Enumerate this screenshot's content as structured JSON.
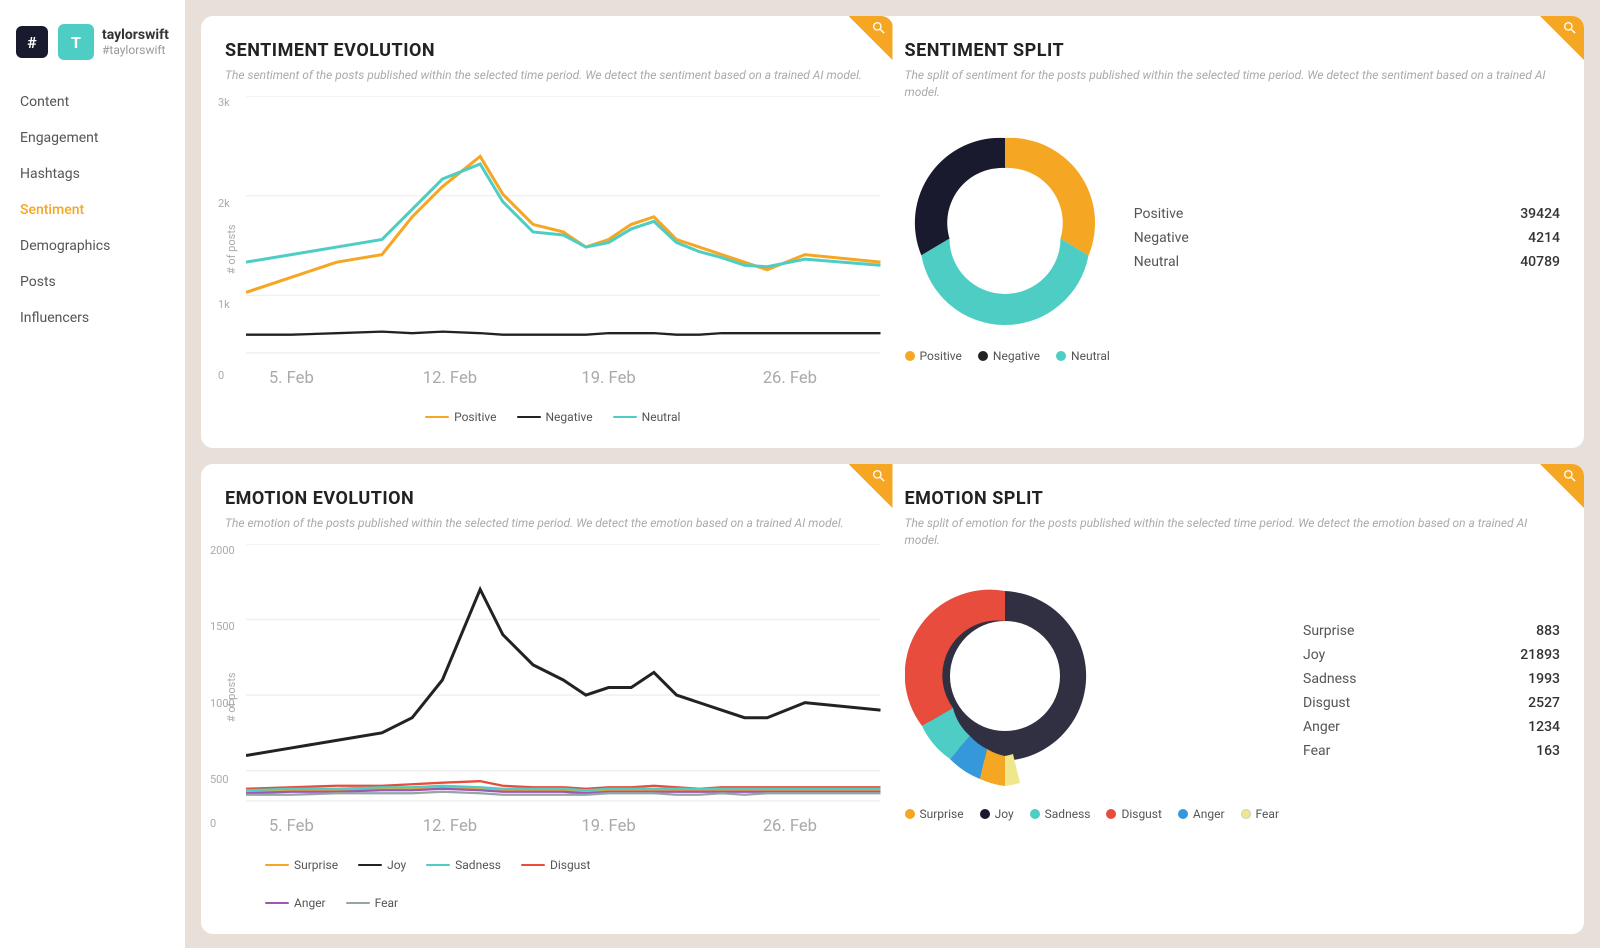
{
  "brand": {
    "hash": "#",
    "avatar_letter": "T",
    "name": "taylorswift",
    "handle": "#taylorswift"
  },
  "nav": {
    "items": [
      {
        "label": "Content",
        "active": false
      },
      {
        "label": "Engagement",
        "active": false
      },
      {
        "label": "Hashtags",
        "active": false
      },
      {
        "label": "Sentiment",
        "active": true
      },
      {
        "label": "Demographics",
        "active": false
      },
      {
        "label": "Posts",
        "active": false
      },
      {
        "label": "Influencers",
        "active": false
      }
    ]
  },
  "sentiment_evolution": {
    "title": "SENTIMENT EVOLUTION",
    "desc": "The sentiment of the posts published within the selected time period. We detect the sentiment based on a trained AI model.",
    "legend": [
      {
        "label": "Positive",
        "color": "#f5a623"
      },
      {
        "label": "Negative",
        "color": "#222222"
      },
      {
        "label": "Neutral",
        "color": "#4ecdc4"
      }
    ],
    "x_labels": [
      "5. Feb",
      "12. Feb",
      "19. Feb",
      "26. Feb"
    ],
    "y_labels": [
      "3k",
      "2k",
      "1k",
      "0"
    ]
  },
  "sentiment_split": {
    "title": "SENTIMENT SPLIT",
    "desc": "The split of sentiment for the posts published within the selected time period. We detect the sentiment based on a trained AI model.",
    "stats": [
      {
        "label": "Positive",
        "value": "39424"
      },
      {
        "label": "Negative",
        "value": "4214"
      },
      {
        "label": "Neutral",
        "value": "40789"
      }
    ],
    "legend": [
      {
        "label": "Positive",
        "color": "#f5a623"
      },
      {
        "label": "Negative",
        "color": "#222222"
      },
      {
        "label": "Neutral",
        "color": "#4ecdc4"
      }
    ]
  },
  "emotion_evolution": {
    "title": "EMOTION EVOLUTION",
    "desc": "The emotion of the posts published within the selected time period. We detect the emotion based on a trained AI model.",
    "legend": [
      {
        "label": "Surprise",
        "color": "#f5a623"
      },
      {
        "label": "Joy",
        "color": "#222222"
      },
      {
        "label": "Sadness",
        "color": "#4ecdc4"
      },
      {
        "label": "Disgust",
        "color": "#e74c3c"
      },
      {
        "label": "Anger",
        "color": "#9b59b6"
      },
      {
        "label": "Fear",
        "color": "#95a5a6"
      }
    ],
    "x_labels": [
      "5. Feb",
      "12. Feb",
      "19. Feb",
      "26. Feb"
    ],
    "y_labels": [
      "2000",
      "1500",
      "1000",
      "500",
      "0"
    ]
  },
  "emotion_split": {
    "title": "EMOTION SPLIT",
    "desc": "The split of emotion for the posts published within the selected time period. We detect the emotion based on a trained AI model.",
    "stats": [
      {
        "label": "Surprise",
        "value": "883"
      },
      {
        "label": "Joy",
        "value": "21893"
      },
      {
        "label": "Sadness",
        "value": "1993"
      },
      {
        "label": "Disgust",
        "value": "2527"
      },
      {
        "label": "Anger",
        "value": "1234"
      },
      {
        "label": "Fear",
        "value": "163"
      }
    ],
    "legend": [
      {
        "label": "Surprise",
        "color": "#f5a623"
      },
      {
        "label": "Joy",
        "color": "#1a1a2e"
      },
      {
        "label": "Sadness",
        "color": "#4ecdc4"
      },
      {
        "label": "Disgust",
        "color": "#e74c3c"
      },
      {
        "label": "Anger",
        "color": "#3498db"
      },
      {
        "label": "Fear",
        "color": "#f0e68c"
      }
    ]
  }
}
